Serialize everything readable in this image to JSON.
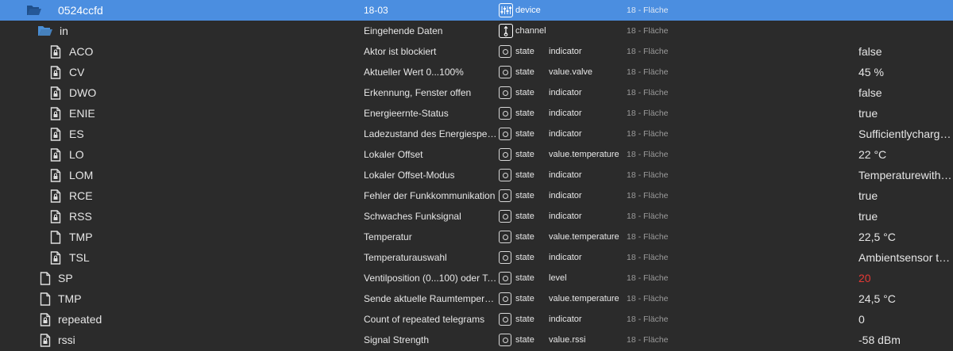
{
  "rows": [
    {
      "name": "0524ccfd",
      "desc": "18-03",
      "type": "device",
      "role": "",
      "room": "18 - Fläche",
      "value": "",
      "icon": "folder-open-icon",
      "selected": true
    },
    {
      "name": "in",
      "desc": "Eingehende Daten",
      "type": "channel",
      "role": "",
      "room": "18 - Fläche",
      "value": "",
      "icon": "folder-open-icon"
    },
    {
      "name": "ACO",
      "desc": "Aktor ist blockiert",
      "type": "state",
      "role": "indicator",
      "room": "18 - Fläche",
      "value": "false",
      "icon": "file-lock-icon"
    },
    {
      "name": "CV",
      "desc": "Aktueller Wert 0...100%",
      "type": "state",
      "role": "value.valve",
      "room": "18 - Fläche",
      "value": "45 %",
      "icon": "file-lock-icon"
    },
    {
      "name": "DWO",
      "desc": "Erkennung, Fenster offen",
      "type": "state",
      "role": "indicator",
      "room": "18 - Fläche",
      "value": "false",
      "icon": "file-lock-icon"
    },
    {
      "name": "ENIE",
      "desc": "Energieernte-Status",
      "type": "state",
      "role": "indicator",
      "room": "18 - Fläche",
      "value": "true",
      "icon": "file-lock-icon"
    },
    {
      "name": "ES",
      "desc": "Ladezustand des Energiespeichers",
      "type": "state",
      "role": "indicator",
      "room": "18 - Fläche",
      "value": "Sufficientlycharged...",
      "icon": "file-lock-icon"
    },
    {
      "name": "LO",
      "desc": "Lokaler Offset",
      "type": "state",
      "role": "value.temperature",
      "room": "18 - Fläche",
      "value": "22 °C",
      "icon": "file-lock-icon"
    },
    {
      "name": "LOM",
      "desc": "Lokaler Offset-Modus",
      "type": "state",
      "role": "indicator",
      "room": "18 - Fläche",
      "value": "Temperaturewith ...",
      "icon": "file-lock-icon"
    },
    {
      "name": "RCE",
      "desc": "Fehler der Funkkommunikation",
      "type": "state",
      "role": "indicator",
      "room": "18 - Fläche",
      "value": "true",
      "icon": "file-lock-icon"
    },
    {
      "name": "RSS",
      "desc": "Schwaches Funksignal",
      "type": "state",
      "role": "indicator",
      "room": "18 - Fläche",
      "value": "true",
      "icon": "file-lock-icon"
    },
    {
      "name": "TMP",
      "desc": "Temperatur",
      "type": "state",
      "role": "value.temperature",
      "room": "18 - Fläche",
      "value": "22,5 °C",
      "icon": "file-icon"
    },
    {
      "name": "TSL",
      "desc": "Temperaturauswahl",
      "type": "state",
      "role": "indicator",
      "room": "18 - Fläche",
      "value": "Ambientsensor te...",
      "icon": "file-lock-icon"
    },
    {
      "name": "SP",
      "desc": "Ventilposition (0...100) oder Te...",
      "type": "state",
      "role": "level",
      "room": "18 - Fläche",
      "value": "20",
      "icon": "file-icon",
      "value_color": "#e53935"
    },
    {
      "name": "TMP",
      "desc": "Sende aktuelle Raumtemperatur",
      "type": "state",
      "role": "value.temperature",
      "room": "18 - Fläche",
      "value": "24,5 °C",
      "icon": "file-icon"
    },
    {
      "name": "repeated",
      "desc": "Count of repeated telegrams",
      "type": "state",
      "role": "indicator",
      "room": "18 - Fläche",
      "value": "0",
      "icon": "file-lock-icon"
    },
    {
      "name": "rssi",
      "desc": "Signal Strength",
      "type": "state",
      "role": "value.rssi",
      "room": "18 - Fläche",
      "value": "-58 dBm",
      "icon": "file-lock-icon"
    }
  ]
}
